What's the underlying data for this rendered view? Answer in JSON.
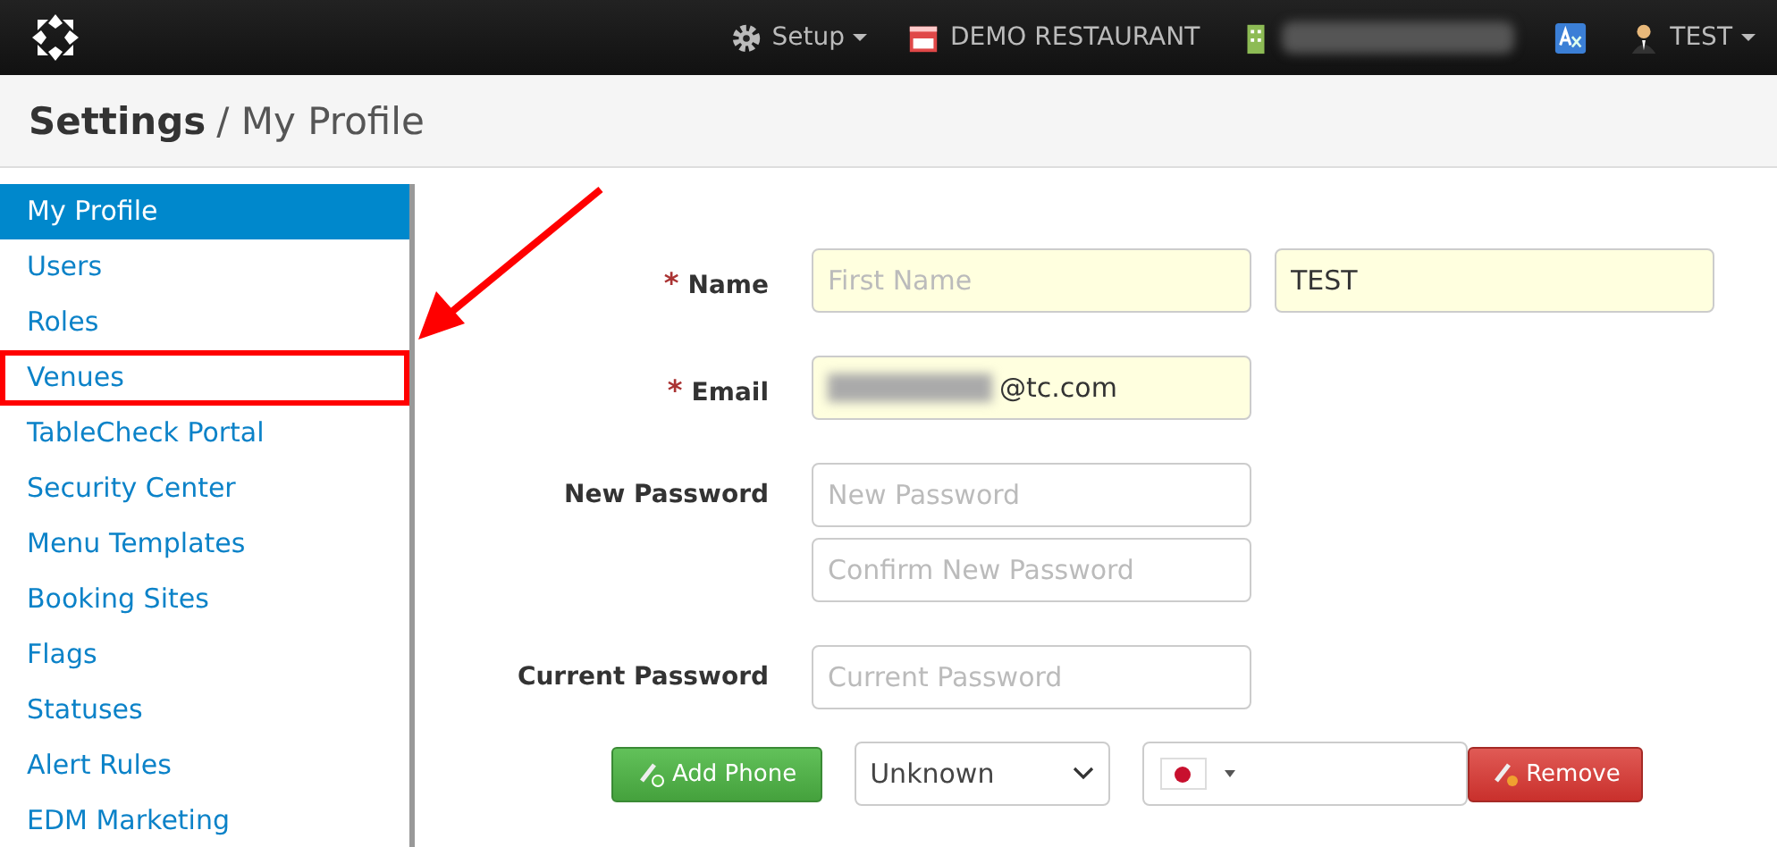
{
  "navbar": {
    "items": [
      {
        "kind": "setup",
        "label": "Setup"
      },
      {
        "kind": "restaurant",
        "label": "DEMO RESTAURANT"
      },
      {
        "kind": "venue-blurred"
      },
      {
        "kind": "translate"
      },
      {
        "kind": "user",
        "label": "TEST"
      }
    ]
  },
  "header": {
    "title": "Settings",
    "separator": "/",
    "subtitle": "My Profile"
  },
  "sidebar": {
    "items": [
      {
        "label": "My Profile",
        "selected": true,
        "highlighted": false
      },
      {
        "label": "Users",
        "selected": false,
        "highlighted": false
      },
      {
        "label": "Roles",
        "selected": false,
        "highlighted": false
      },
      {
        "label": "Venues",
        "selected": false,
        "highlighted": true
      },
      {
        "label": "TableCheck Portal",
        "selected": false,
        "highlighted": false
      },
      {
        "label": "Security Center",
        "selected": false,
        "highlighted": false
      },
      {
        "label": "Menu Templates",
        "selected": false,
        "highlighted": false
      },
      {
        "label": "Booking Sites",
        "selected": false,
        "highlighted": false
      },
      {
        "label": "Flags",
        "selected": false,
        "highlighted": false
      },
      {
        "label": "Statuses",
        "selected": false,
        "highlighted": false
      },
      {
        "label": "Alert Rules",
        "selected": false,
        "highlighted": false
      },
      {
        "label": "EDM Marketing",
        "selected": false,
        "highlighted": false
      }
    ]
  },
  "form": {
    "required_mark": "*",
    "rows": [
      {
        "label": "Name",
        "required": true,
        "fields": [
          {
            "placeholder": "First Name",
            "required": true
          },
          {
            "value": "TEST",
            "required": true
          }
        ]
      },
      {
        "label": "Email",
        "required": true,
        "fields": [
          {
            "value": "@tc.com",
            "blurred_prefix": true,
            "required": true
          }
        ]
      },
      {
        "label": "New Password",
        "required": false,
        "fields": [
          {
            "placeholder": "New Password",
            "required": false
          },
          {
            "placeholder": "Confirm New Password",
            "required": false
          }
        ]
      },
      {
        "label": "Current Password",
        "required": false,
        "fields": [
          {
            "placeholder": "Current Password",
            "required": false
          }
        ]
      }
    ],
    "phone": {
      "add_button": "Add Phone",
      "type": "Unknown",
      "remove_button": "Remove"
    }
  },
  "annotation": {
    "arrow": true
  }
}
